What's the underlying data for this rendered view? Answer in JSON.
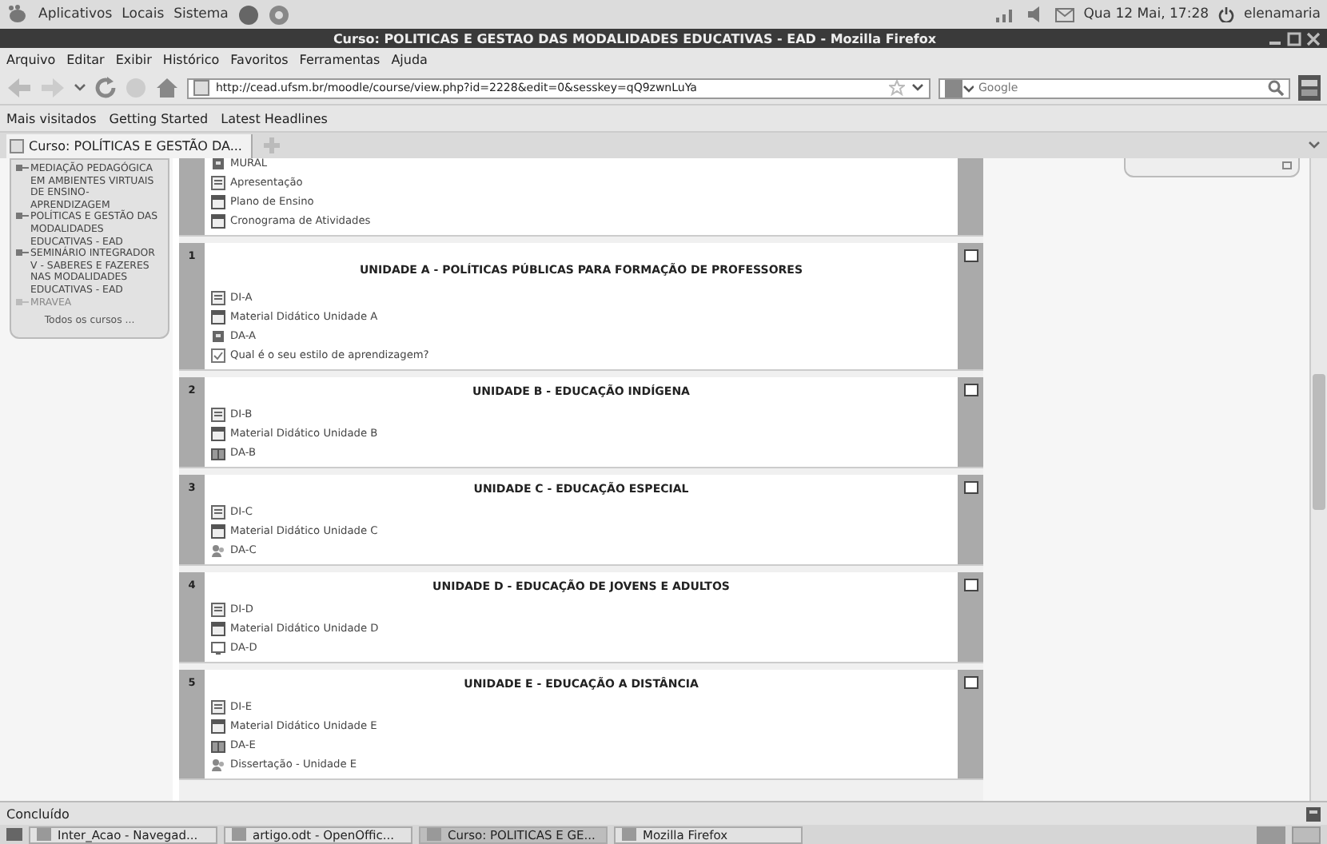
{
  "top_panel": {
    "menus": [
      "Aplicativos",
      "Locais",
      "Sistema"
    ],
    "clock": "Qua 12 Mai, 17:28",
    "user": "elenamaria"
  },
  "window": {
    "title": "Curso: POLITICAS E GESTAO DAS MODALIDADES EDUCATIVAS - EAD - Mozilla Firefox"
  },
  "menu_bar": [
    "Arquivo",
    "Editar",
    "Exibir",
    "Histórico",
    "Favoritos",
    "Ferramentas",
    "Ajuda"
  ],
  "address": {
    "url": "http://cead.ufsm.br/moodle/course/view.php?id=2228&edit=0&sesskey=qQ9zwnLuYa"
  },
  "search": {
    "placeholder": "Google"
  },
  "bookmarks": [
    "Mais visitados",
    "Getting Started",
    "Latest Headlines"
  ],
  "tabs": [
    {
      "label": "Curso: POLÍTICAS E GESTÃO DA...",
      "selected": true
    }
  ],
  "sidebar": {
    "courses": [
      {
        "label": "MEDIAÇÃO PEDAGÓGICA EM AMBIENTES VIRTUAIS DE ENSINO-APRENDIZAGEM",
        "dimmed": false
      },
      {
        "label": "POLÍTICAS E GESTÃO DAS MODALIDADES EDUCATIVAS - EAD",
        "dimmed": false
      },
      {
        "label": "SEMINÁRIO INTEGRADOR V - SABERES E FAZERES NAS MODALIDADES EDUCATIVAS - EAD",
        "dimmed": false
      },
      {
        "label": "MRAVEA",
        "dimmed": true
      }
    ],
    "all_courses": "Todos os cursos ..."
  },
  "sections": [
    {
      "items": [
        {
          "kind": "forum",
          "label": "MURAL"
        },
        {
          "kind": "page",
          "label": "Apresentação"
        },
        {
          "kind": "file",
          "label": "Plano de Ensino"
        },
        {
          "kind": "file",
          "label": "Cronograma de Atividades"
        }
      ]
    },
    {
      "number": "1",
      "title": "UNIDADE A - POLÍTICAS PÚBLICAS PARA FORMAÇÃO DE PROFESSORES",
      "items": [
        {
          "kind": "page",
          "label": "DI-A"
        },
        {
          "kind": "file",
          "label": "Material Didático Unidade A"
        },
        {
          "kind": "forum",
          "label": "DA-A"
        },
        {
          "kind": "choice",
          "label": "Qual é o seu estilo de aprendizagem?"
        }
      ]
    },
    {
      "number": "2",
      "title": "UNIDADE B - EDUCAÇÃO INDÍGENA",
      "items": [
        {
          "kind": "page",
          "label": "DI-B"
        },
        {
          "kind": "file",
          "label": "Material Didático Unidade B"
        },
        {
          "kind": "glossary",
          "label": "DA-B"
        }
      ]
    },
    {
      "number": "3",
      "title": "UNIDADE C - EDUCAÇÃO ESPECIAL",
      "items": [
        {
          "kind": "page",
          "label": "DI-C"
        },
        {
          "kind": "file",
          "label": "Material Didático Unidade C"
        },
        {
          "kind": "wiki",
          "label": "DA-C"
        }
      ]
    },
    {
      "number": "4",
      "title": "UNIDADE D - EDUCAÇÃO DE JOVENS E ADULTOS",
      "items": [
        {
          "kind": "page",
          "label": "DI-D"
        },
        {
          "kind": "file",
          "label": "Material Didático Unidade D"
        },
        {
          "kind": "assignment",
          "label": "DA-D"
        }
      ]
    },
    {
      "number": "5",
      "title": "UNIDADE E - EDUCAÇÃO A DISTÂNCIA",
      "items": [
        {
          "kind": "page",
          "label": "DI-E"
        },
        {
          "kind": "file",
          "label": "Material Didático Unidade E"
        },
        {
          "kind": "glossary",
          "label": "DA-E"
        },
        {
          "kind": "wiki",
          "label": "Dissertação - Unidade E"
        }
      ]
    }
  ],
  "status_bar": "Concluído",
  "taskbar": [
    {
      "label": "Inter_Acao - Navegad...",
      "selected": false
    },
    {
      "label": "artigo.odt - OpenOffic...",
      "selected": false
    },
    {
      "label": "Curso: POLITICAS E GE...",
      "selected": true
    },
    {
      "label": "Mozilla Firefox",
      "selected": false
    }
  ]
}
